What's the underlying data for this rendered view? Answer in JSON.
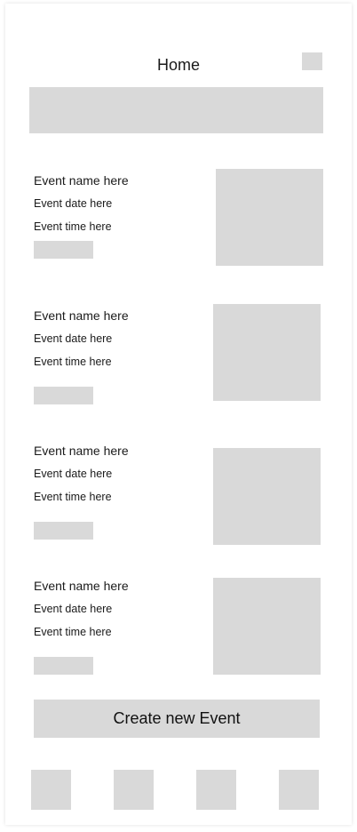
{
  "header": {
    "title": "Home"
  },
  "events": [
    {
      "name": "Event name here",
      "date": "Event date here",
      "time": "Event time here"
    },
    {
      "name": "Event name here",
      "date": "Event date here",
      "time": "Event time here"
    },
    {
      "name": "Event name here",
      "date": "Event date here",
      "time": "Event time here"
    },
    {
      "name": "Event name here",
      "date": "Event date here",
      "time": "Event time here"
    }
  ],
  "actions": {
    "create_event_label": "Create new Event"
  },
  "colors": {
    "placeholder": "#d9d9d9",
    "text": "#1a1a1a",
    "background": "#ffffff"
  }
}
